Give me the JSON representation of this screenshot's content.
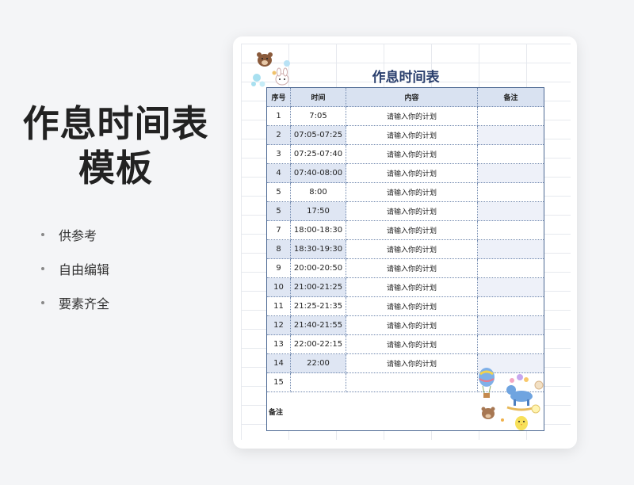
{
  "promo": {
    "title_line1": "作息时间表",
    "title_line2": "模板",
    "bullets": [
      "供参考",
      "自由编辑",
      "要素齐全"
    ]
  },
  "document": {
    "title": "作息时间表",
    "headers": [
      "序号",
      "时间",
      "内容",
      "备注"
    ],
    "rows": [
      {
        "num": "1",
        "time": "7:05",
        "content": "请输入你的计划",
        "note": ""
      },
      {
        "num": "2",
        "time": "07:05-07:25",
        "content": "请输入你的计划",
        "note": ""
      },
      {
        "num": "3",
        "time": "07:25-07:40",
        "content": "请输入你的计划",
        "note": ""
      },
      {
        "num": "4",
        "time": "07:40-08:00",
        "content": "请输入你的计划",
        "note": ""
      },
      {
        "num": "5",
        "time": "8:00",
        "content": "请输入你的计划",
        "note": ""
      },
      {
        "num": "5",
        "time": "17:50",
        "content": "请输入你的计划",
        "note": ""
      },
      {
        "num": "7",
        "time": "18:00-18:30",
        "content": "请输入你的计划",
        "note": ""
      },
      {
        "num": "8",
        "time": "18:30-19:30",
        "content": "请输入你的计划",
        "note": ""
      },
      {
        "num": "9",
        "time": "20:00-20:50",
        "content": "请输入你的计划",
        "note": ""
      },
      {
        "num": "10",
        "time": "21:00-21:25",
        "content": "请输入你的计划",
        "note": ""
      },
      {
        "num": "11",
        "time": "21:25-21:35",
        "content": "请输入你的计划",
        "note": ""
      },
      {
        "num": "12",
        "time": "21:40-21:55",
        "content": "请输入你的计划",
        "note": ""
      },
      {
        "num": "13",
        "time": "22:00-22:15",
        "content": "请输入你的计划",
        "note": ""
      },
      {
        "num": "14",
        "time": "22:00",
        "content": "请输入你的计划",
        "note": ""
      },
      {
        "num": "15",
        "time": "",
        "content": "",
        "note": ""
      }
    ],
    "footer_label": "备注"
  },
  "colors": {
    "title": "#2a3f6d",
    "header_fill": "#d9e2f1",
    "shade_fill": "#dfe6f3",
    "border": "#4e6a94"
  },
  "decorations": [
    "bear-stickers-icon",
    "hot-air-balloon-icon",
    "rocking-horse-icon",
    "chick-icon"
  ]
}
